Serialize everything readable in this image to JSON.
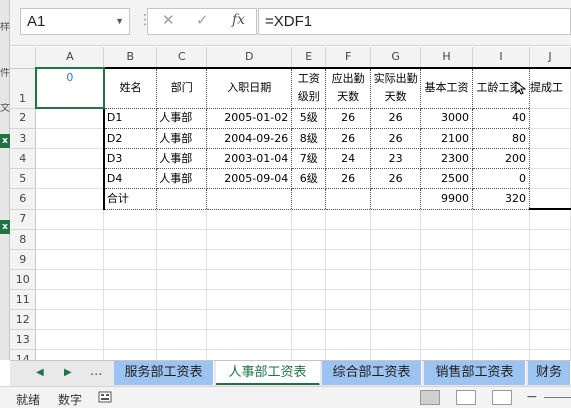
{
  "left_strip": {
    "chars": [
      "样",
      "件",
      "文"
    ],
    "badges": [
      "x",
      "x"
    ]
  },
  "formula_bar": {
    "name_box": "A1",
    "dropdown_icon": "chevron-down-icon",
    "cancel_icon": "close-icon",
    "enter_icon": "check-icon",
    "fx_label": "fx",
    "formula": "=XDF1"
  },
  "grid": {
    "columns": [
      "A",
      "B",
      "C",
      "D",
      "E",
      "F",
      "G",
      "H",
      "I",
      "J"
    ],
    "rows": [
      "1",
      "2",
      "3",
      "4",
      "5",
      "6",
      "7",
      "8",
      "9",
      "10",
      "11",
      "12",
      "13",
      "14"
    ],
    "a1_value": "0",
    "headers": [
      "姓名",
      "部门",
      "入职日期",
      "工资级别",
      "应出勤天数",
      "实际出勤天数",
      "基本工资",
      "工龄工资",
      "提成工"
    ],
    "data_rows": [
      [
        "D1",
        "人事部",
        "2005-01-02",
        "5级",
        "26",
        "26",
        "3000",
        "40"
      ],
      [
        "D2",
        "人事部",
        "2004-09-26",
        "8级",
        "26",
        "26",
        "2100",
        "80"
      ],
      [
        "D3",
        "人事部",
        "2003-01-04",
        "7级",
        "24",
        "23",
        "2300",
        "200"
      ],
      [
        "D4",
        "人事部",
        "2005-09-04",
        "6级",
        "26",
        "26",
        "2500",
        "0"
      ]
    ],
    "total_row": [
      "合计",
      "",
      "",
      "",
      "",
      "",
      "9900",
      "320"
    ]
  },
  "sheet_tabs": {
    "nav_prev": "◀",
    "nav_next": "▶",
    "nav_more": "...",
    "tabs": [
      "服务部工资表",
      "人事部工资表",
      "综合部工资表",
      "销售部工资表",
      "财务"
    ],
    "active": "人事部工资表"
  },
  "status_bar": {
    "ready": "就绪",
    "mode": "数字",
    "macro_icon": "macro-record-icon"
  }
}
